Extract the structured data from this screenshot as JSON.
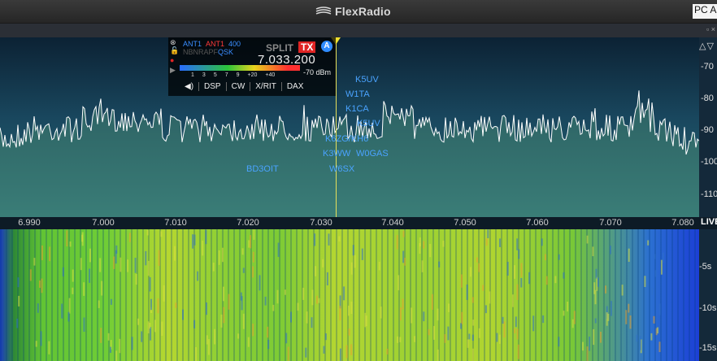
{
  "titlebar": {
    "app_name": "FlexRadio",
    "right_label": "PC A"
  },
  "subbar": {
    "controls": "▫ ×"
  },
  "panadapter": {
    "dbm_scale": [
      "-70",
      "-80",
      "-90",
      "-100",
      "-110"
    ],
    "scale_arrows": "△▽",
    "freq_axis": [
      "6.990",
      "7.000",
      "7.010",
      "7.020",
      "7.030",
      "7.040",
      "7.050",
      "7.060",
      "7.070",
      "7.080"
    ],
    "live_label": "LIVE",
    "spots": [
      "K5UV",
      "W1TA",
      "K1CA",
      "K5UV",
      "K6ZG/KH6",
      "K3WW",
      "W0GAS",
      "BD3OIT",
      "W6SX"
    ]
  },
  "slice": {
    "ant_rx": "ANT1",
    "ant_tx": "ANT1",
    "filter": "400",
    "row2_grey": "NBNRAPF",
    "row2_qsk": "QSK",
    "split_label": "SPLIT",
    "tx_label": "TX",
    "slice_letter": "A",
    "frequency": "7.033.200",
    "smeter_labels": [
      "1",
      "3",
      "5",
      "7",
      "9",
      "+20",
      "+40"
    ],
    "smeter_dbm": "-70 dBm",
    "buttons": [
      "◀)",
      "DSP",
      "CW",
      "X/RIT",
      "DAX"
    ]
  },
  "waterfall": {
    "time_labels": [
      "-5s",
      "-10s",
      "-15s"
    ]
  },
  "colors": {
    "tx_red": "#e02424",
    "spot_blue": "#4aa3ff",
    "slice_yellow": "#e7e05a"
  }
}
